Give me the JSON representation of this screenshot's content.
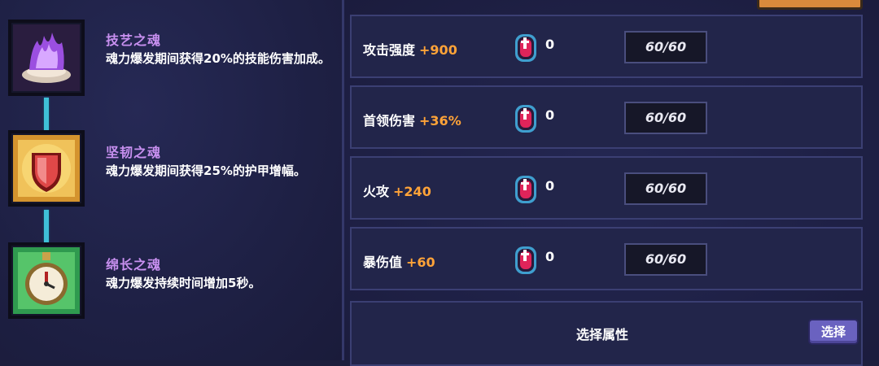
{
  "skills": [
    {
      "name": "技艺之魂",
      "desc": "魂力爆发期间获得20%的技能伤害加成。",
      "icon": "purple-flame-icon"
    },
    {
      "name": "坚韧之魂",
      "desc": "魂力爆发期间获得25%的护甲增幅。",
      "icon": "red-shield-icon"
    },
    {
      "name": "绵长之魂",
      "desc": "魂力爆发持续时间增加5秒。",
      "icon": "green-pocket-watch-icon"
    }
  ],
  "stats": [
    {
      "label": "攻击强度",
      "bonus": "+900",
      "count": "0",
      "cap": "60/60"
    },
    {
      "label": "首领伤害",
      "bonus": "+36%",
      "count": "0",
      "cap": "60/60"
    },
    {
      "label": "火攻",
      "bonus": "+240",
      "count": "0",
      "cap": "60/60"
    },
    {
      "label": "暴伤值",
      "bonus": "+60",
      "count": "0",
      "cap": "60/60"
    }
  ],
  "select": {
    "title": "选择属性",
    "button": "选择"
  },
  "colors": {
    "accent_orange": "#ffa338",
    "skill_name_purple": "#c890f0",
    "connector": "#3fc0d8",
    "button": "#6a62c0"
  }
}
